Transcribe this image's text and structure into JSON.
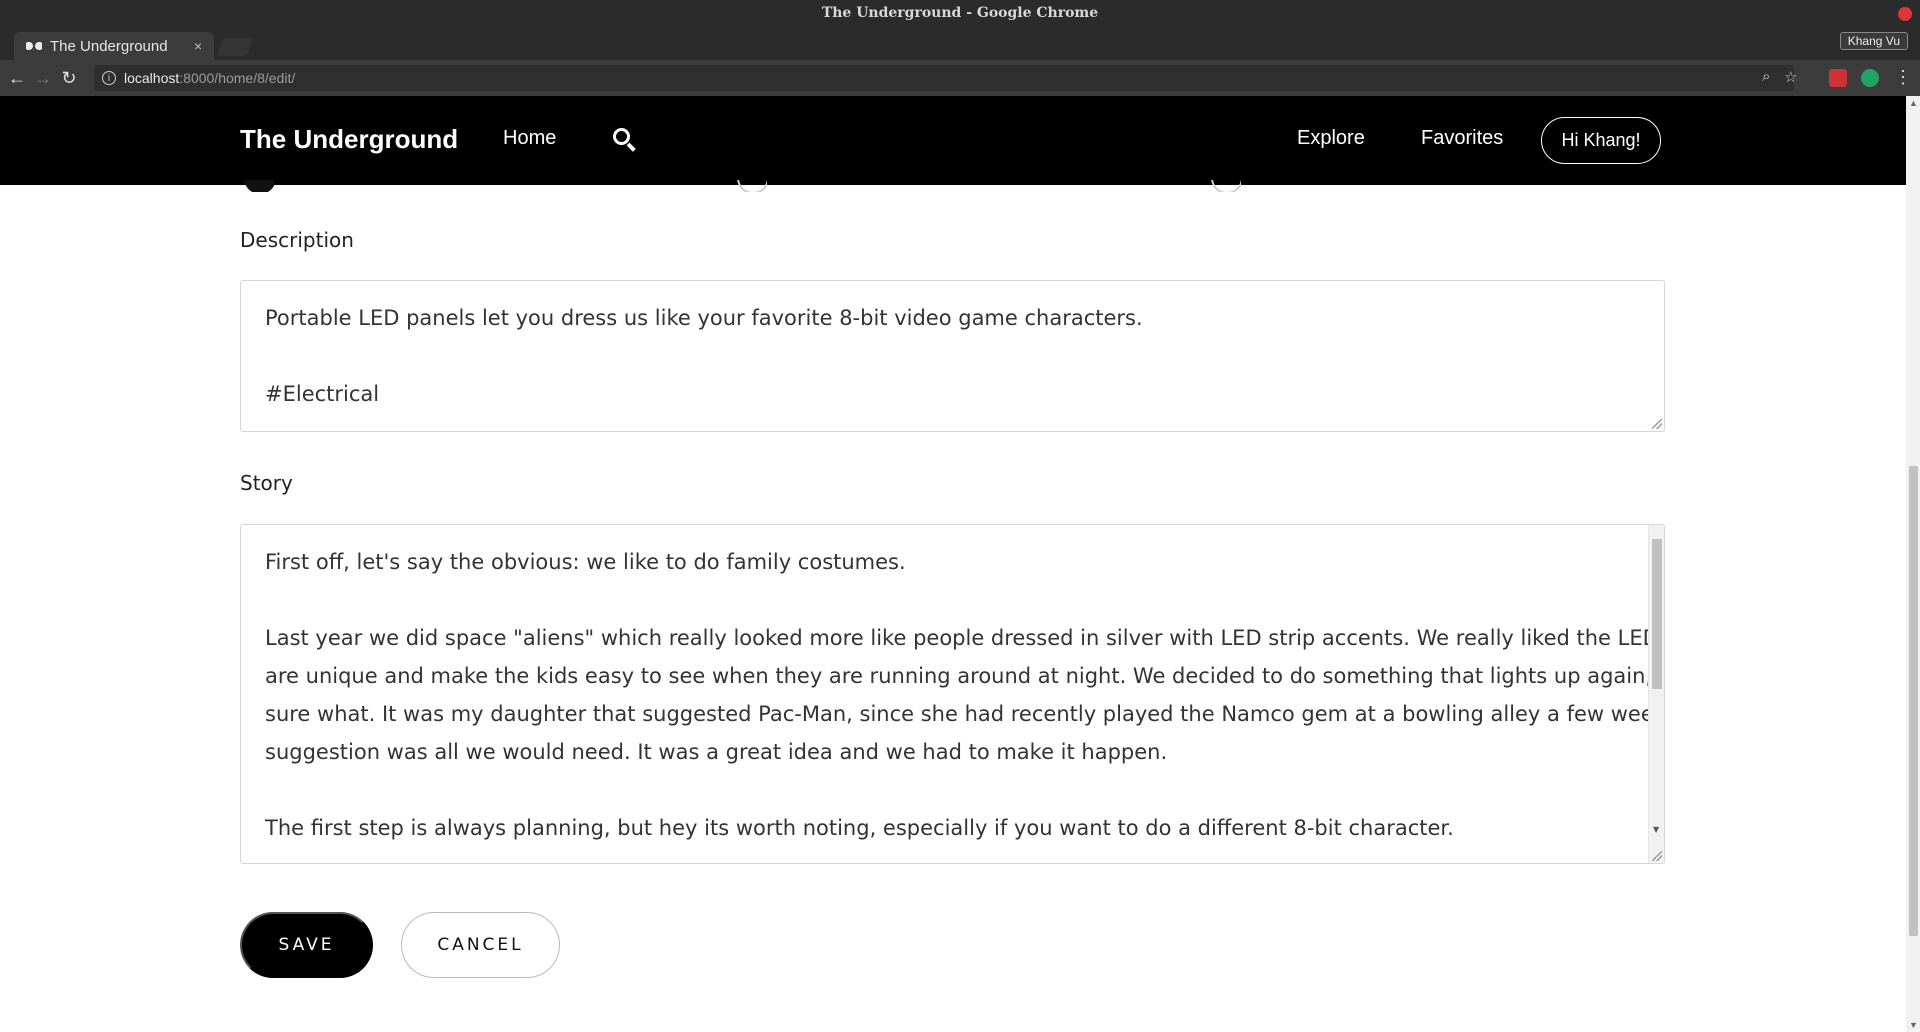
{
  "window": {
    "title": "The Underground - Google Chrome",
    "profile": "Khang Vu"
  },
  "tab": {
    "title": "The Underground",
    "close": "×"
  },
  "address": {
    "host": "localhost",
    "path": ":8000/home/8/edit/"
  },
  "nav": {
    "brand": "The Underground",
    "home": "Home",
    "explore": "Explore",
    "favorites": "Favorites",
    "user": "Hi Khang!"
  },
  "form": {
    "description_label": "Description",
    "description_lines": [
      "Portable LED panels let you dress us like your favorite 8-bit video game characters.",
      "",
      "#Electrical"
    ],
    "story_label": "Story",
    "story_lines": [
      "First off, let's say the obvious: we like to do family costumes.",
      "",
      "Last year we did space \"aliens\" which really looked more like people dressed in silver with LED strip accents. We really liked the LEDs since they",
      "are unique and make the kids easy to see when they are running around at night. We decided to do something that lights up again, but weren't",
      "sure what. It was my daughter that suggested Pac-Man, since she had recently played the Namco gem at a bowling alley a few weeks prior. That",
      "suggestion was all we would need. It was a great idea and we had to make it happen.",
      "",
      "The first step is always planning, but hey its worth noting, especially if you want to do a different 8-bit character."
    ],
    "save_label": "SAVE",
    "cancel_label": "CANCEL"
  },
  "colors": {
    "nav_bg": "#000000",
    "save_bg": "#000000",
    "chrome_bg": "#2b2b2b"
  }
}
